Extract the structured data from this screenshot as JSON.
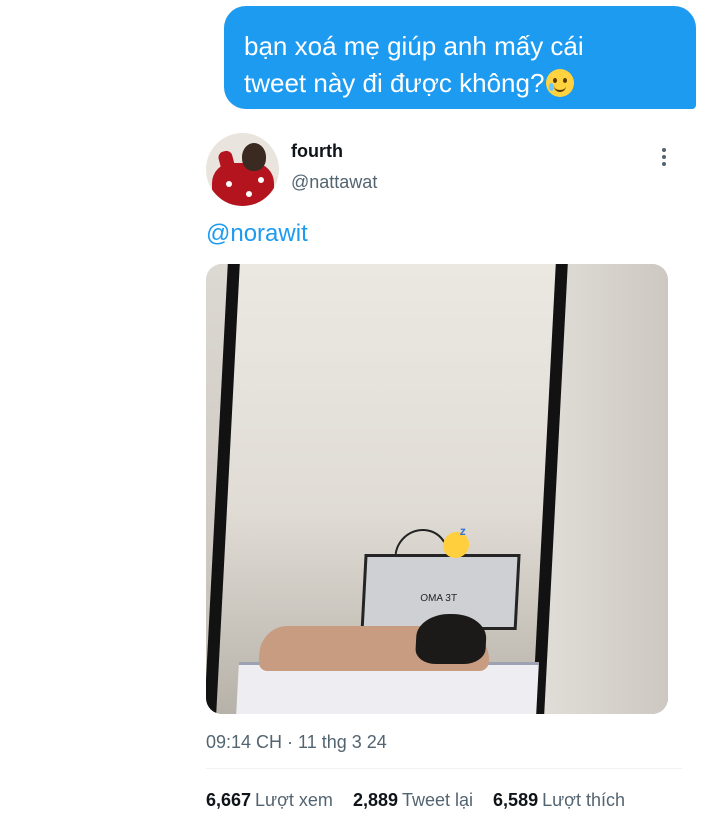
{
  "message": {
    "line1": "bạn xoá mẹ giúp anh mấy cái",
    "line2": "tweet này đi được không?",
    "emoji": "smiling-face-with-tear"
  },
  "tweet": {
    "name": "fourth",
    "handle": "@nattawat",
    "mention": "@norawit",
    "timestamp": "09:14 CH · 11 thg 3 24",
    "media_overlay_emoji": "sleeping-face",
    "media_text": "OMA 3T",
    "stats": [
      {
        "count": "6,667",
        "label": "Lượt xem"
      },
      {
        "count": "2,889",
        "label": "Tweet lại"
      },
      {
        "count": "6,589",
        "label": "Lượt thích"
      }
    ]
  },
  "colors": {
    "accent": "#1d9bf0",
    "secondary_text": "#536471",
    "primary_text": "#0f1419"
  }
}
